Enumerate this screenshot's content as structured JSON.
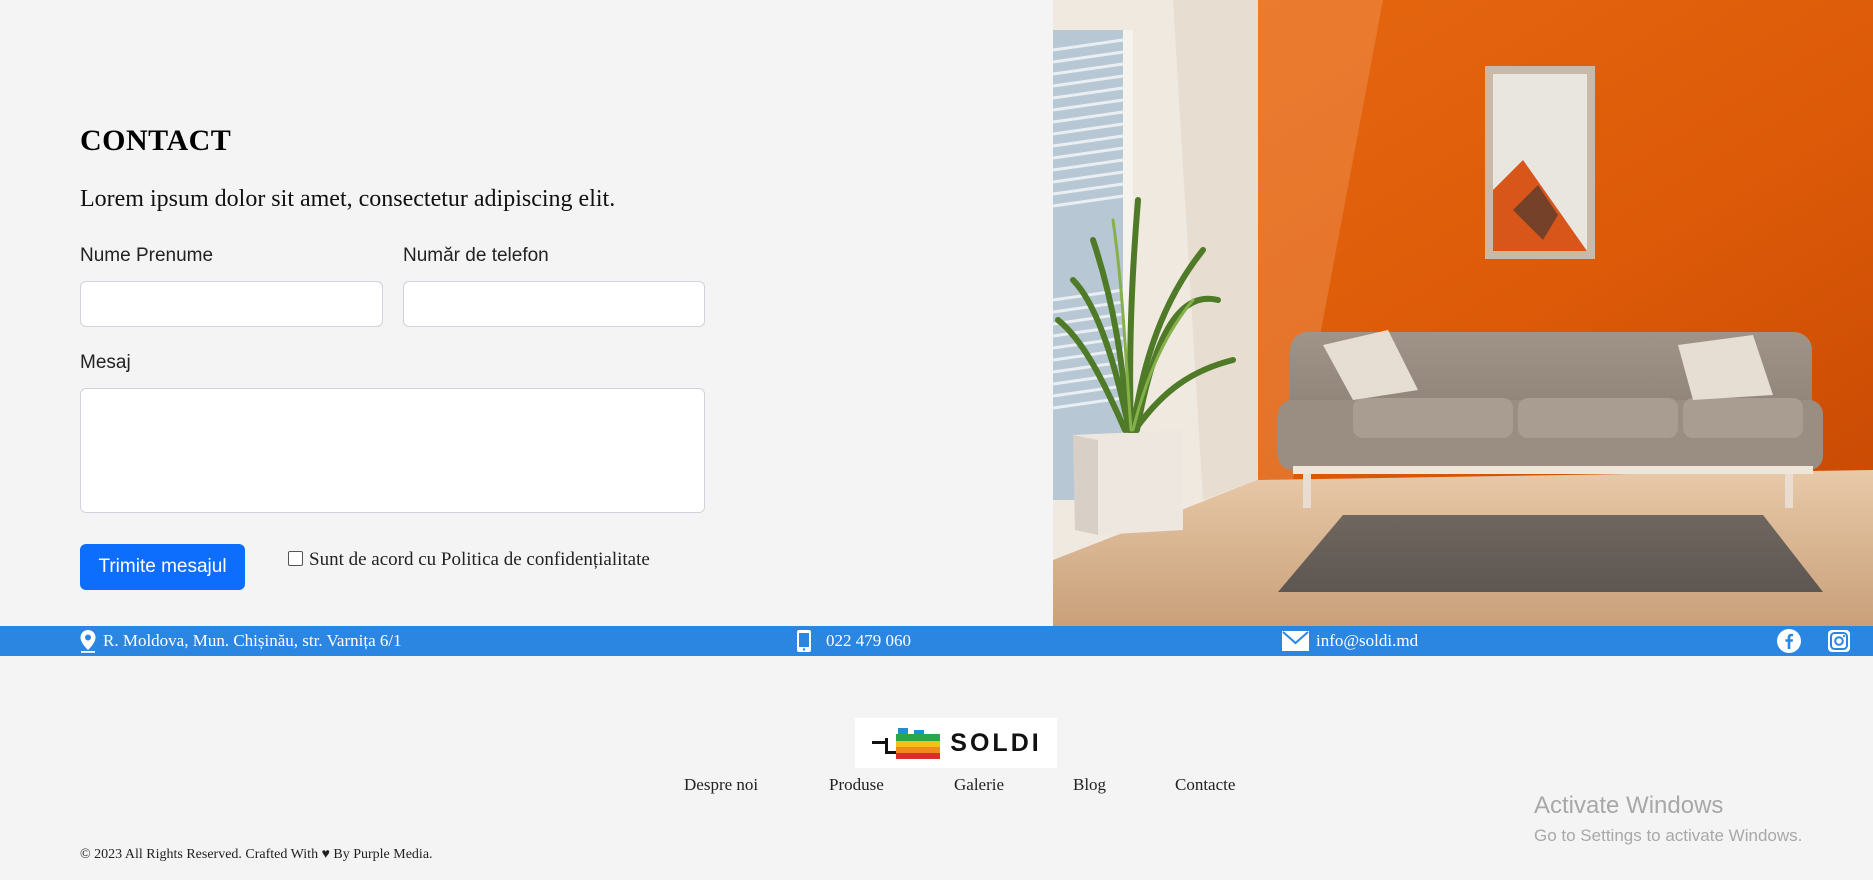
{
  "contact": {
    "title": "CONTACT",
    "subtitle": "Lorem ipsum dolor sit amet, consectetur adipiscing elit.",
    "name_label": "Nume Prenume",
    "name_value": "",
    "phone_label": "Număr de telefon",
    "phone_value": "",
    "message_label": "Mesaj",
    "message_value": "",
    "submit_label": "Trimite mesajul",
    "agree_label": "Sunt de acord cu Politica de confidențialitate",
    "agree_checked": false
  },
  "info_bar": {
    "address": "R. Moldova, Mun. Chișinău, str. Varnița 6/1",
    "phone": "022 479 060",
    "email": "info@soldi.md",
    "social": [
      "facebook-icon",
      "instagram-icon"
    ],
    "background_color": "#2a86e0"
  },
  "footer": {
    "logo_text": "SOLDI",
    "nav": [
      "Despre noi",
      "Produse",
      "Galerie",
      "Blog",
      "Contacte"
    ],
    "copyright": "© 2023 All Rights Reserved. Crafted With ♥ By Purple Media."
  },
  "watermark": {
    "title": "Activate Windows",
    "subtitle": "Go to Settings to activate Windows."
  },
  "colors": {
    "accent": "#0d6efd",
    "page_background": "#f4f4f4",
    "wall": "#e0600c"
  }
}
